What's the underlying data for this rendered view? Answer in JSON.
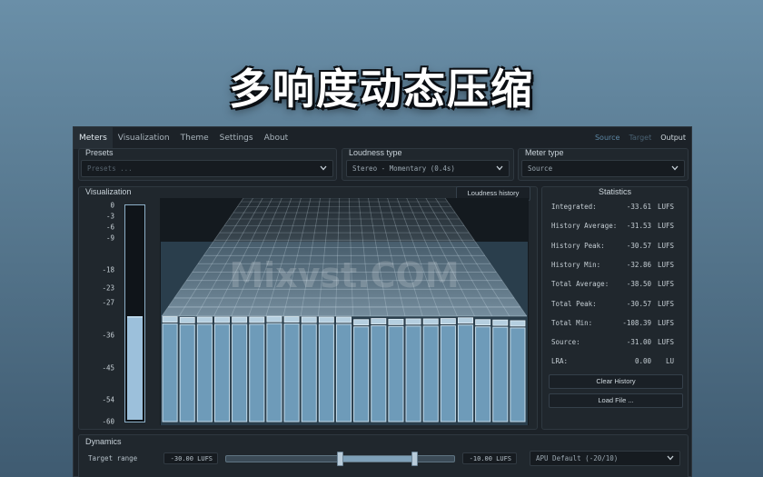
{
  "banner": {
    "title": "多响度动态压缩"
  },
  "tabs": [
    {
      "label": "Meters",
      "active": true
    },
    {
      "label": "Visualization"
    },
    {
      "label": "Theme"
    },
    {
      "label": "Settings"
    },
    {
      "label": "About"
    }
  ],
  "outputs": {
    "source": "Source",
    "target": "Target",
    "output": "Output"
  },
  "presets": {
    "label": "Presets",
    "placeholder": "Presets ..."
  },
  "loudness_type": {
    "label": "Loudness type",
    "value": "Stereo - Momentary (0.4s)"
  },
  "meter_type": {
    "label": "Meter type",
    "value": "Source"
  },
  "visualization": {
    "label": "Visualization",
    "history_button": "Loudness history",
    "scale_ticks": [
      "0",
      "-3",
      "-6",
      "-9",
      "-18",
      "-23",
      "-27",
      "-36",
      "-45",
      "-54",
      "-60"
    ],
    "meter_level_db": -31.0,
    "watermark": "Mixvst.COM",
    "bar_levels_db": [
      -30.9,
      -31.1,
      -31.0,
      -31.0,
      -31.0,
      -31.0,
      -30.8,
      -30.9,
      -31.0,
      -31.0,
      -31.0,
      -31.7,
      -31.4,
      -31.6,
      -31.5,
      -31.5,
      -31.4,
      -31.2,
      -31.7,
      -31.8,
      -32.0
    ]
  },
  "statistics": {
    "title": "Statistics",
    "rows": [
      {
        "label": "Integrated:",
        "value": "-33.61",
        "unit": "LUFS"
      },
      {
        "label": "History Average:",
        "value": "-31.53",
        "unit": "LUFS"
      },
      {
        "label": "History Peak:",
        "value": "-30.57",
        "unit": "LUFS"
      },
      {
        "label": "History Min:",
        "value": "-32.86",
        "unit": "LUFS"
      },
      {
        "label": "Total Average:",
        "value": "-38.50",
        "unit": "LUFS"
      },
      {
        "label": "Total Peak:",
        "value": "-30.57",
        "unit": "LUFS"
      },
      {
        "label": "Total Min:",
        "value": "-108.39",
        "unit": "LUFS"
      },
      {
        "label": "Source:",
        "value": "-31.00",
        "unit": "LUFS"
      },
      {
        "label": "LRA:",
        "value": "0.00",
        "unit": "LU"
      }
    ],
    "clear_button": "Clear History",
    "load_button": "Load File ..."
  },
  "dynamics": {
    "label": "Dynamics",
    "target_range_label": "Target range",
    "min_value": "-30.00 LUFS",
    "max_value": "-10.00 LUFS",
    "range_min_lufs": -30,
    "range_max_lufs": -10,
    "mode": "APU Default (-20/10)"
  }
}
